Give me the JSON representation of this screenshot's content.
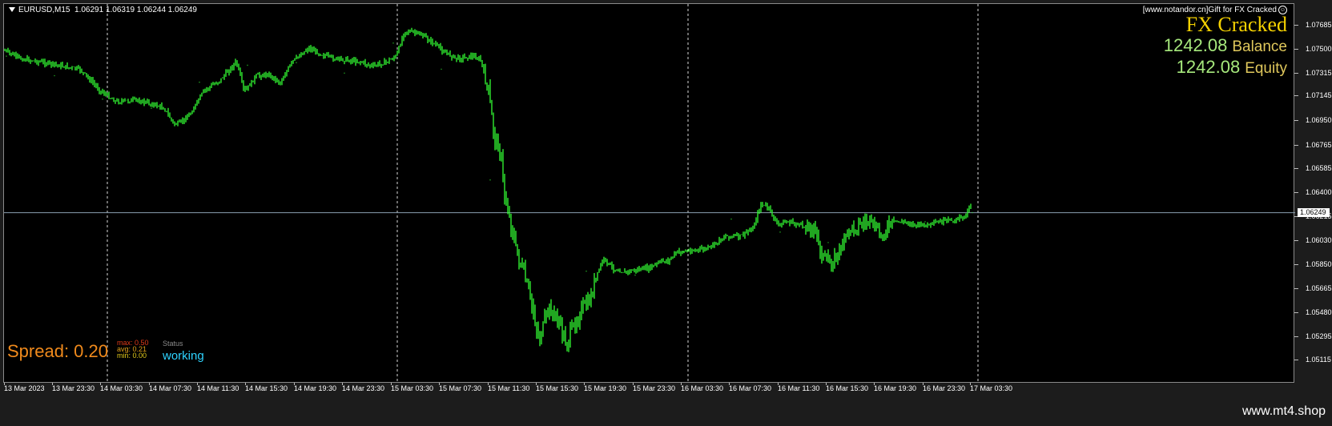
{
  "chart_header": {
    "symbol": "EURUSD,M15",
    "ohlc": "1.06291 1.06319 1.06244 1.06249"
  },
  "ea_panel": {
    "banner": "[www.notandor.cn]Gift for FX Cracked",
    "title": "FX Cracked",
    "balance_value": "1242.08",
    "balance_label": "Balance",
    "equity_value": "1242.08",
    "equity_label": "Equity"
  },
  "spread_panel": {
    "spread": "Spread: 0.20",
    "max": "max: 0.50",
    "avg": "avg: 0.21",
    "min": "min: 0.00",
    "status_label": "Status",
    "status_value": "working"
  },
  "current_price": "1.06249",
  "watermark": "www.mt4.shop",
  "colors": {
    "background": "#000000",
    "candle": "#33ff33",
    "grid": "#ffffff",
    "bid_line": "#8aa0b0",
    "title_yellow": "#f5d100",
    "balance_green": "#a6e87c",
    "spread_orange": "#f08a1c",
    "status_cyan": "#2ed3ff"
  },
  "chart_data": {
    "type": "line",
    "symbol": "EURUSD",
    "timeframe": "M15",
    "ylim": [
      1.0511,
      1.0777
    ],
    "y_tick_labels": [
      "1.07685",
      "1.07500",
      "1.07315",
      "1.07145",
      "1.06950",
      "1.06765",
      "1.06585",
      "1.06400",
      "1.06215",
      "1.06030",
      "1.05850",
      "1.05665",
      "1.05480",
      "1.05295",
      "1.05115"
    ],
    "x_tick_labels": [
      "13 Mar 2023",
      "13 Mar 23:30",
      "14 Mar 03:30",
      "14 Mar 07:30",
      "14 Mar 11:30",
      "14 Mar 15:30",
      "14 Mar 19:30",
      "14 Mar 23:30",
      "15 Mar 03:30",
      "15 Mar 07:30",
      "15 Mar 11:30",
      "15 Mar 15:30",
      "15 Mar 19:30",
      "15 Mar 23:30",
      "16 Mar 03:30",
      "16 Mar 07:30",
      "16 Mar 11:30",
      "16 Mar 15:30",
      "16 Mar 19:30",
      "16 Mar 23:30",
      "17 Mar 03:30"
    ],
    "series": [
      {
        "name": "EURUSD",
        "x": [
          "13 Mar 2023",
          "13 Mar 23:30",
          "14 Mar 03:30",
          "14 Mar 07:30",
          "14 Mar 11:30",
          "14 Mar 15:30",
          "14 Mar 19:30",
          "14 Mar 23:30",
          "15 Mar 03:30",
          "15 Mar 07:30",
          "15 Mar 11:30",
          "15 Mar 15:30",
          "15 Mar 19:30",
          "15 Mar 23:30",
          "16 Mar 03:30",
          "16 Mar 07:30",
          "16 Mar 11:30",
          "16 Mar 15:30",
          "16 Mar 19:30",
          "16 Mar 23:30",
          "17 Mar 03:30"
        ],
        "y": [
          1.0745,
          1.073,
          1.0712,
          1.0705,
          1.0725,
          1.0738,
          1.074,
          1.0732,
          1.0755,
          1.0735,
          1.065,
          1.0535,
          1.058,
          1.0577,
          1.0595,
          1.062,
          1.061,
          1.0602,
          1.0614,
          1.0618,
          1.0625
        ]
      }
    ],
    "dashed_vertical_gridlines_at": [
      "13 Mar 23:30",
      "14 Mar 23:30",
      "15 Mar 23:30",
      "16 Mar 23:30"
    ],
    "grid": true
  }
}
